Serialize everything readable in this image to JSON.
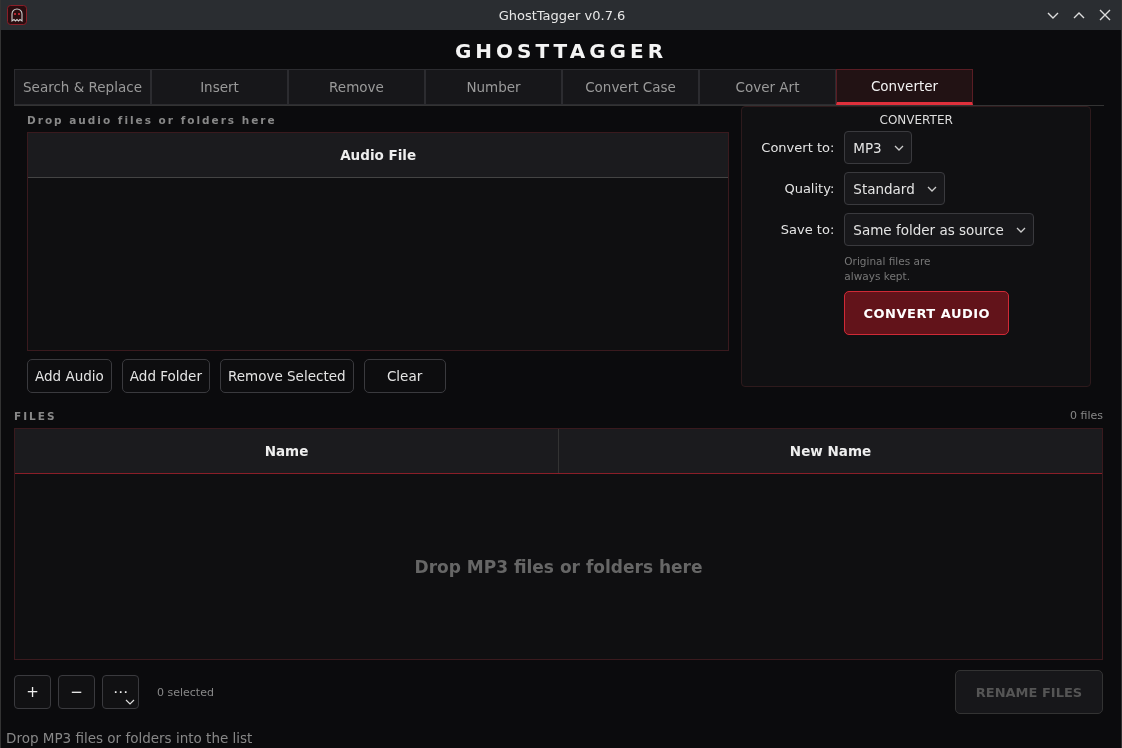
{
  "window": {
    "title": "GhostTagger v0.7.6"
  },
  "app_title": "GHOSTTAGGER",
  "tabs": [
    {
      "label": "Search & Replace",
      "selected": false
    },
    {
      "label": "Insert",
      "selected": false
    },
    {
      "label": "Remove",
      "selected": false
    },
    {
      "label": "Number",
      "selected": false
    },
    {
      "label": "Convert Case",
      "selected": false
    },
    {
      "label": "Cover Art",
      "selected": false
    },
    {
      "label": "Converter",
      "selected": true
    }
  ],
  "audio_list": {
    "hint": "Drop audio files or folders here",
    "columns": [
      "Audio File"
    ],
    "buttons": [
      "Add Audio",
      "Add Folder",
      "Remove Selected",
      "Clear"
    ]
  },
  "converter_panel": {
    "heading": "CONVERTER",
    "fields": [
      {
        "label": "Convert to:",
        "value": "MP3"
      },
      {
        "label": "Quality:",
        "value": "Standard"
      },
      {
        "label": "Save to:",
        "value": "Same folder as source"
      }
    ],
    "note": "Original files are always kept.",
    "button": "CONVERT AUDIO"
  },
  "files": {
    "heading": "FILES",
    "count": "0 files",
    "columns": [
      "Name",
      "New Name"
    ],
    "placeholder": "Drop MP3 files or folders here"
  },
  "bottom_bar": {
    "buttons": [
      "+",
      "−",
      "⋯"
    ],
    "selection": "0 selected",
    "rename_button": {
      "label": "RENAME FILES",
      "disabled": true
    }
  },
  "status_bar": "Drop MP3 files or folders into the list"
}
